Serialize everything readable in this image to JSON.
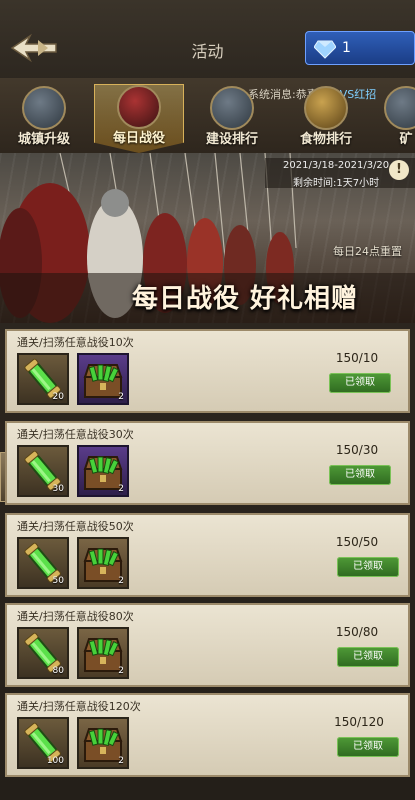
{
  "header": {
    "title": "活动",
    "gems": "1"
  },
  "ticker": {
    "prefix": "系统消息:恭喜",
    "highlight": "陈全VS红招"
  },
  "tabs": [
    {
      "label": "城镇升级",
      "active": false
    },
    {
      "label": "每日战役",
      "active": true
    },
    {
      "label": "建设排行",
      "active": false
    },
    {
      "label": "食物排行",
      "active": false
    },
    {
      "label": "矿",
      "active": false
    }
  ],
  "banner": {
    "date_range": "2021/3/18-2021/3/20",
    "remaining": "剩余时间:1天7小时",
    "info": "!",
    "reset": "每日24点重置",
    "slogan": "每日战役  好礼相赠"
  },
  "tasks": [
    {
      "label": "通关/扫荡任意战役10次",
      "items": [
        {
          "kind": "potion",
          "count": "20"
        },
        {
          "kind": "chest-purple",
          "count": "2"
        }
      ],
      "progress": "150/10",
      "button": "已领取"
    },
    {
      "label": "通关/扫荡任意战役30次",
      "items": [
        {
          "kind": "potion",
          "count": "30"
        },
        {
          "kind": "chest-purple",
          "count": "2"
        }
      ],
      "progress": "150/30",
      "button": "已领取"
    },
    {
      "label": "通关/扫荡任意战役50次",
      "items": [
        {
          "kind": "potion",
          "count": "50"
        },
        {
          "kind": "chest-brown",
          "count": "2"
        }
      ],
      "progress": "150/50",
      "button": "已领取"
    },
    {
      "label": "通关/扫荡任意战役80次",
      "items": [
        {
          "kind": "potion",
          "count": "80"
        },
        {
          "kind": "chest-brown",
          "count": "2"
        }
      ],
      "progress": "150/80",
      "button": "已领取"
    },
    {
      "label": "通关/扫荡任意战役120次",
      "items": [
        {
          "kind": "potion",
          "count": "100"
        },
        {
          "kind": "chest-brown",
          "count": "2"
        }
      ],
      "progress": "150/120",
      "button": "已领取"
    }
  ]
}
